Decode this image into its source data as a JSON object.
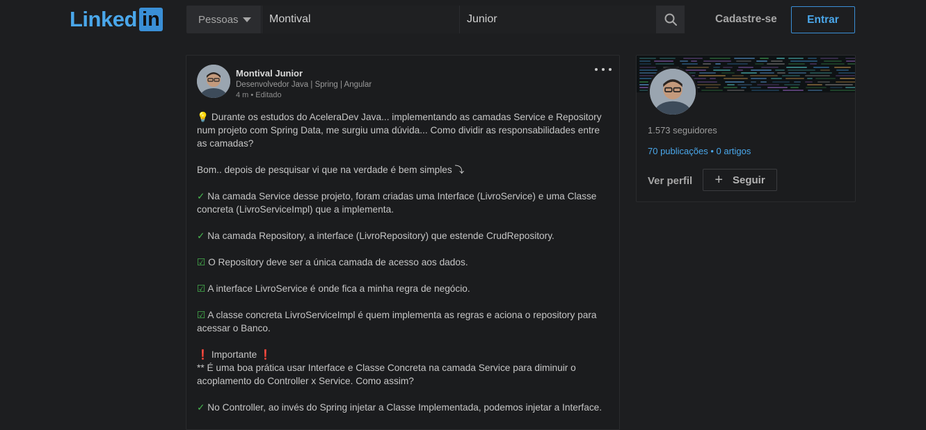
{
  "brand": {
    "logo_text": "Linked",
    "logo_box": "in"
  },
  "header": {
    "search_type": "Pessoas",
    "first_name_value": "Montival",
    "last_name_value": "Junior",
    "signup_label": "Cadastre-se",
    "signin_label": "Entrar"
  },
  "post": {
    "author_name": "Montival Junior",
    "author_headline": "Desenvolvedor Java | Spring | Angular",
    "meta": "4 m • Editado",
    "paragraphs": [
      {
        "icon": "💡",
        "text": " Durante os estudos do AceleraDev Java... implementando as camadas Service e Repository num projeto com Spring Data, me surgiu uma dúvida... Como dividir as responsabilidades entre as camadas?"
      },
      {
        "icon": "",
        "text": "Bom.. depois de pesquisar vi que na verdade é bem simples ⤵"
      },
      {
        "icon": "✓",
        "text": " Na camada Service desse projeto, foram criadas uma Interface (LivroService) e uma Classe concreta (LivroServiceImpl) que a implementa."
      },
      {
        "icon": "✓",
        "text": " Na camada Repository, a interface (LivroRepository) que estende CrudRepository."
      },
      {
        "icon": "☑",
        "text": " O Repository deve ser a única camada de acesso aos dados."
      },
      {
        "icon": "☑",
        "text": " A interface LivroService é onde fica a minha regra de negócio."
      },
      {
        "icon": "☑",
        "text": " A classe concreta LivroServiceImpl é quem implementa as regras e aciona o repository para acessar o Banco."
      },
      {
        "icon": "",
        "text": "❗  Importante ❗\n** É uma boa prática usar Interface e Classe Concreta na camada Service para diminuir o acoplamento do Controller x Service. Como assim?"
      },
      {
        "icon": "✓",
        "text": " No Controller, ao invés do Spring injetar a Classe Implementada, podemos injetar a Interface."
      }
    ]
  },
  "profile": {
    "followers": "1.573 seguidores",
    "publications": "70 publicações",
    "separator": " • ",
    "articles": "0 artigos",
    "view_profile": "Ver perfil",
    "follow_label": "Seguir"
  },
  "colors": {
    "accent": "#4aa7ea",
    "background": "#1d1e20",
    "check_green": "#46b34e"
  }
}
